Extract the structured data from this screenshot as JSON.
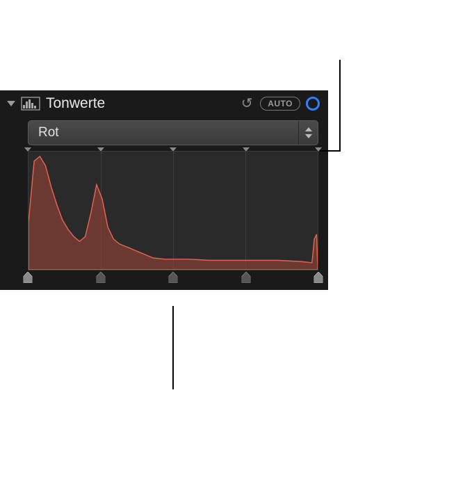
{
  "header": {
    "title": "Tonwerte",
    "auto_label": "AUTO"
  },
  "dropdown": {
    "selected": "Rot"
  },
  "handles": {
    "positions_pct": [
      0,
      25,
      50,
      75,
      100
    ]
  },
  "chart_data": {
    "type": "area",
    "title": "",
    "xlabel": "",
    "ylabel": "",
    "xlim": [
      0,
      255
    ],
    "ylim": [
      0,
      100
    ],
    "series": [
      {
        "name": "Rot",
        "color": "#cc5b4a",
        "x": [
          0,
          5,
          10,
          15,
          20,
          25,
          30,
          35,
          40,
          45,
          50,
          55,
          60,
          65,
          70,
          75,
          80,
          85,
          90,
          95,
          100,
          110,
          120,
          130,
          140,
          160,
          180,
          200,
          220,
          240,
          250,
          252,
          254,
          255
        ],
        "values": [
          40,
          92,
          96,
          88,
          70,
          55,
          42,
          34,
          28,
          24,
          28,
          48,
          72,
          60,
          36,
          26,
          22,
          20,
          18,
          16,
          14,
          10,
          9,
          9,
          9,
          8,
          8,
          8,
          8,
          7,
          6,
          26,
          30,
          4
        ]
      }
    ],
    "gridlines_x_pct": [
      25,
      50,
      75
    ]
  }
}
